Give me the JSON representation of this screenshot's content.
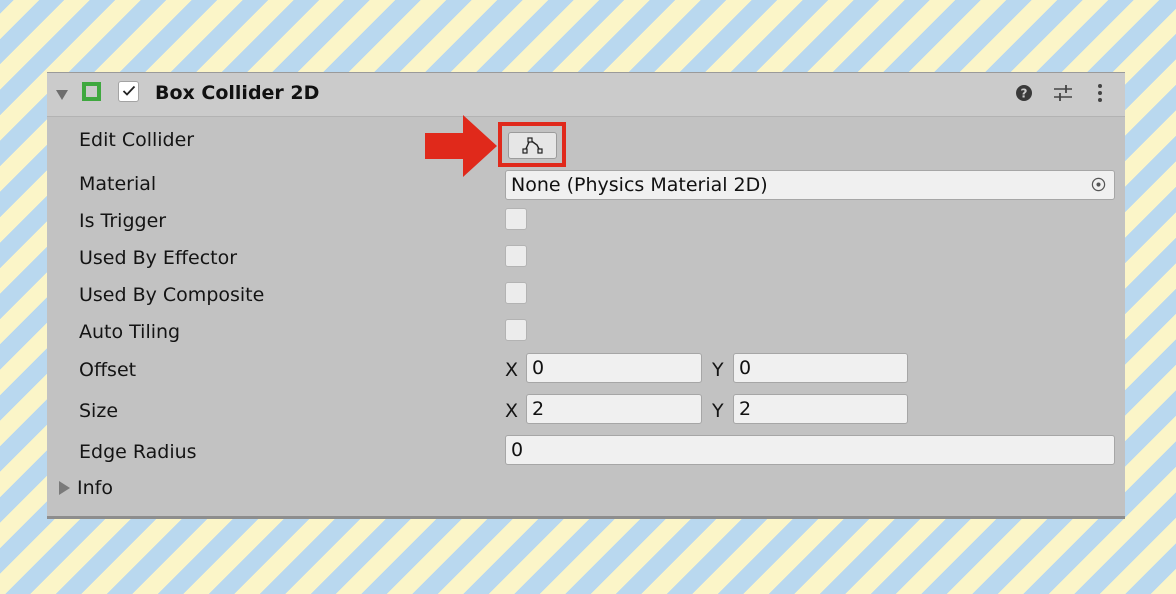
{
  "component": {
    "title": "Box Collider 2D",
    "icon": "box-collider-2d-icon",
    "icon_color": "#3fa83f",
    "enabled": true,
    "header_icons": [
      "help-icon",
      "presets-icon",
      "menu-icon"
    ]
  },
  "properties": {
    "edit_collider": {
      "label": "Edit Collider",
      "button_icon": "edit-collider-icon"
    },
    "material": {
      "label": "Material",
      "value": "None (Physics Material 2D)"
    },
    "is_trigger": {
      "label": "Is Trigger",
      "checked": false
    },
    "used_by_effector": {
      "label": "Used By Effector",
      "checked": false
    },
    "used_by_composite": {
      "label": "Used By Composite",
      "checked": false
    },
    "auto_tiling": {
      "label": "Auto Tiling",
      "checked": false
    },
    "offset": {
      "label": "Offset",
      "x_label": "X",
      "x": "0",
      "y_label": "Y",
      "y": "0"
    },
    "size": {
      "label": "Size",
      "x_label": "X",
      "x": "2",
      "y_label": "Y",
      "y": "2"
    },
    "edge_radius": {
      "label": "Edge Radius",
      "value": "0"
    }
  },
  "info": {
    "label": "Info",
    "expanded": false
  },
  "annotation": {
    "highlight_color": "#e0291b",
    "arrow_color": "#e0291b"
  }
}
